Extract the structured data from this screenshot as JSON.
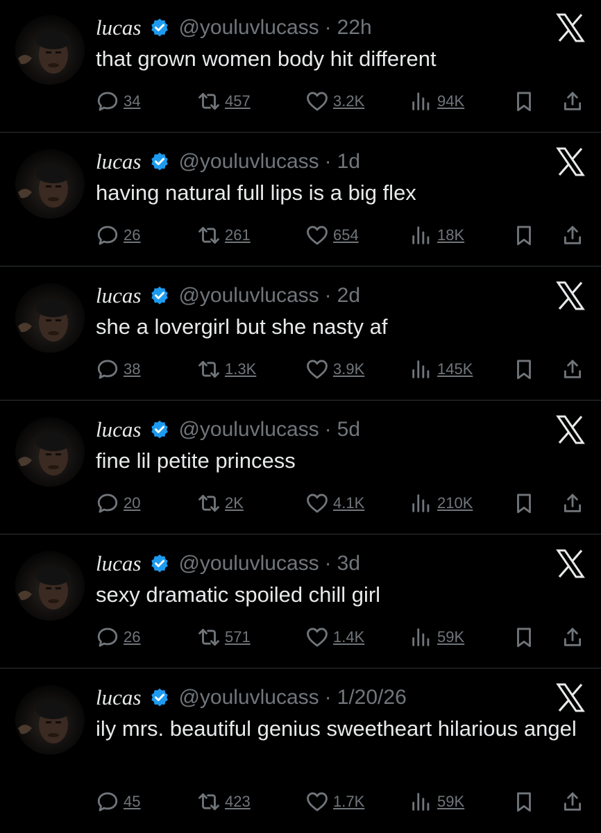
{
  "tweets": [
    {
      "name": "lucas",
      "handle": "@youluvlucass",
      "time": "22h",
      "text": "that grown women body hit different",
      "replies": "34",
      "reposts": "457",
      "likes": "3.2K",
      "views": "94K"
    },
    {
      "name": "lucas",
      "handle": "@youluvlucass",
      "time": "1d",
      "text": "having natural full lips is a big flex",
      "replies": "26",
      "reposts": "261",
      "likes": "654",
      "views": "18K"
    },
    {
      "name": "lucas",
      "handle": "@youluvlucass",
      "time": "2d",
      "text": "she a lovergirl but she nasty af",
      "replies": "38",
      "reposts": "1.3K",
      "likes": "3.9K",
      "views": "145K"
    },
    {
      "name": "lucas",
      "handle": "@youluvlucass",
      "time": "5d",
      "text": "fine lil petite princess",
      "replies": "20",
      "reposts": "2K",
      "likes": "4.1K",
      "views": "210K"
    },
    {
      "name": "lucas",
      "handle": "@youluvlucass",
      "time": "3d",
      "text": "sexy dramatic spoiled chill girl",
      "replies": "26",
      "reposts": "571",
      "likes": "1.4K",
      "views": "59K"
    },
    {
      "name": "lucas",
      "handle": "@youluvlucass",
      "time": "1/20/26",
      "text": "ily mrs. beautiful genius sweetheart hilarious angel",
      "replies": "45",
      "reposts": "423",
      "likes": "1.7K",
      "views": "59K"
    }
  ],
  "separator": "·",
  "colors": {
    "background": "#000000",
    "text": "#e7e9ea",
    "muted": "#71767b",
    "verified": "#1d9bf0",
    "divider": "#2f3336"
  },
  "icons": {
    "verified": "verified-badge-icon",
    "logo": "x-logo-icon",
    "reply": "reply-icon",
    "repost": "repost-icon",
    "like": "like-icon",
    "views": "views-icon",
    "bookmark": "bookmark-icon",
    "share": "share-icon"
  }
}
